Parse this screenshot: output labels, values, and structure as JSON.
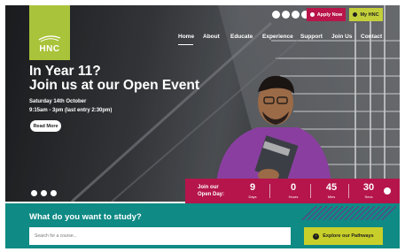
{
  "brand": {
    "logo_text": "HNC",
    "logo_color": "#a9c33a"
  },
  "utility": {
    "social_icons": [
      "search-icon",
      "facebook-icon",
      "twitter-icon",
      "instagram-icon"
    ],
    "apply_label": "Apply Now",
    "myhnc_label": "My HNC"
  },
  "nav": {
    "items": [
      "Home",
      "About",
      "Educate",
      "Experience",
      "Support",
      "Join Us",
      "Contact"
    ],
    "active": "Home"
  },
  "hero": {
    "headline_line1": "In Year 11?",
    "headline_line2": "Join us at our Open Event",
    "date": "Saturday 14th October",
    "time": "9:15am - 3pm (last entry 2:30pm)",
    "cta_label": "Read More"
  },
  "countdown": {
    "label_line1": "Join our",
    "label_line2": "Open Day:",
    "units": [
      {
        "value": "9",
        "unit": "Days"
      },
      {
        "value": "0",
        "unit": "Hours"
      },
      {
        "value": "45",
        "unit": "Mins"
      },
      {
        "value": "30",
        "unit": "Secs"
      }
    ]
  },
  "study": {
    "title": "What do you want to study?",
    "search_placeholder": "Search for a course...",
    "explore_label": "Explore our Pathways"
  },
  "colors": {
    "accent_red": "#b5154b",
    "accent_lime": "#c3cf3a",
    "teal": "#0f8a84"
  }
}
